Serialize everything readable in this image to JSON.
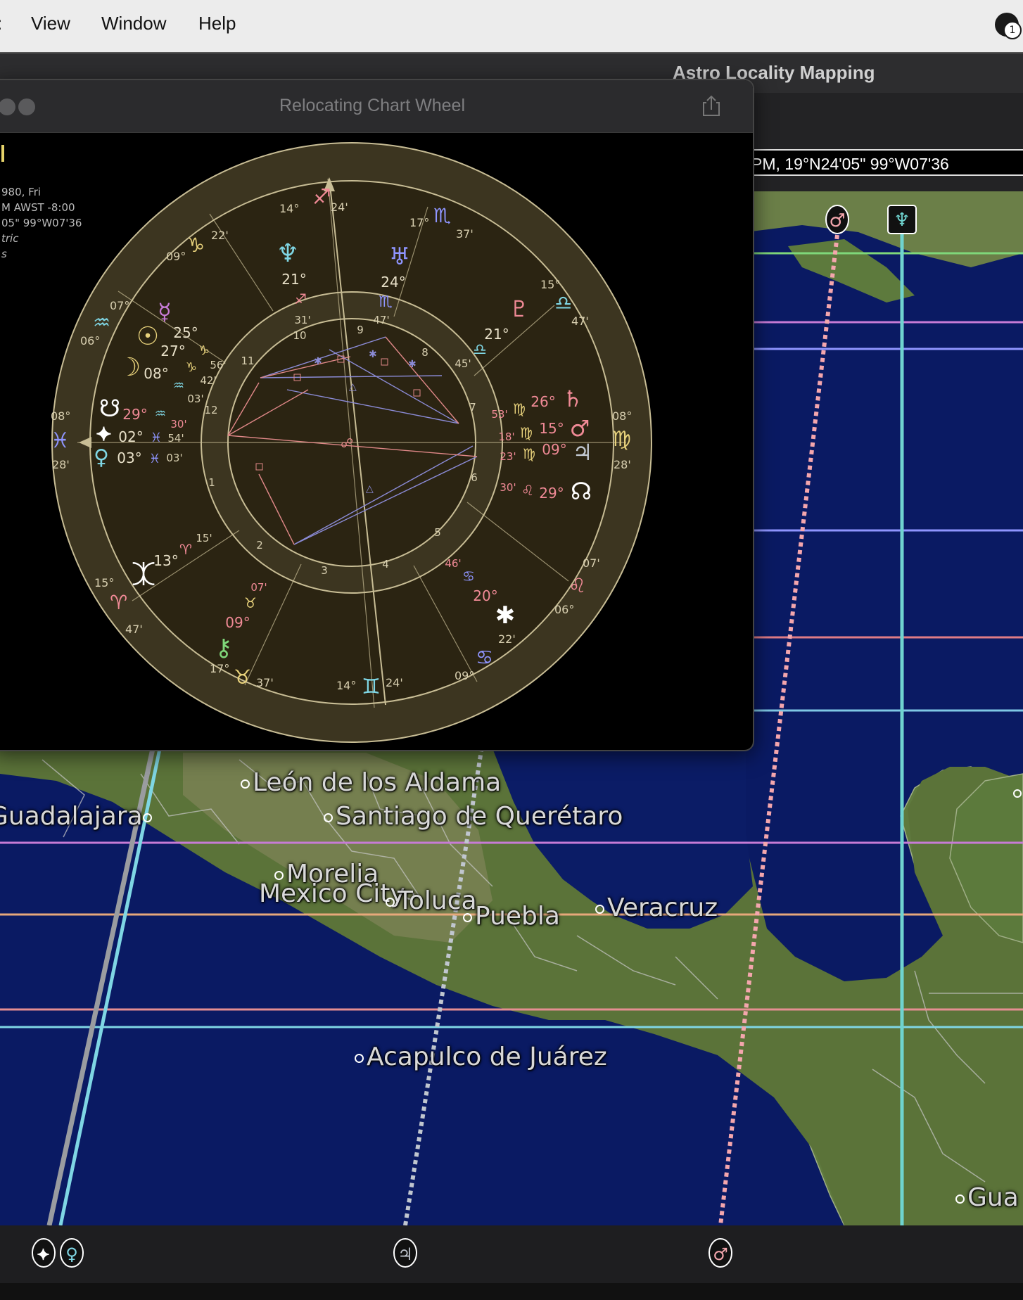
{
  "menu": {
    "items": [
      "View",
      "Window",
      "Help"
    ],
    "notification_count": "1"
  },
  "main_window": {
    "title": "Astro Locality Mapping",
    "location_field": "PM, 19°N24'05\" 99°W07'36"
  },
  "chart_window": {
    "title": "Relocating Chart Wheel",
    "side_info": [
      "980, Fri",
      "M AWST -8:00",
      "05\" 99°W07'36",
      "tric",
      "s"
    ]
  },
  "map": {
    "cities": [
      {
        "name": "León de los Aldama"
      },
      {
        "name": "Guadalajara"
      },
      {
        "name": "Santiago de Querétaro"
      },
      {
        "name": "Morelia"
      },
      {
        "name": "Mexico City"
      },
      {
        "name": "Toluca"
      },
      {
        "name": "Puebla"
      },
      {
        "name": "Veracruz"
      },
      {
        "name": "Acapulco de Juárez"
      },
      {
        "name": "Gua"
      }
    ],
    "top_line_markers": [
      "mars-glyph",
      "neptune-glyph"
    ],
    "bottom_line_markers": [
      "chiron-glyph",
      "venus-glyph",
      "jupiter-glyph",
      "mars-glyph"
    ],
    "line_colors": {
      "mars": "#f4a6ad",
      "neptune": "#6fd3cf",
      "venus": "#7fd6e4",
      "jupiter": "#c0c6cf",
      "mercury_h": "#c77bd6",
      "moon_h": "#8f95ff",
      "sun_h": "#e7a87b",
      "green_h": "#7fd77a"
    }
  },
  "wheel": {
    "cusps": {
      "asc": {
        "deg": "08°",
        "min": "28'",
        "sign": "♓"
      },
      "dsc": {
        "deg": "08°",
        "min": "28'",
        "sign": "♍"
      },
      "mc": {
        "deg": "14°",
        "min": "24'",
        "sign": "♐"
      },
      "ic": {
        "deg": "14°",
        "min": "24'",
        "sign": "♊"
      },
      "c11": {
        "deg": "17°",
        "min": "37'",
        "sign": "♏"
      },
      "c12": {
        "deg": "15°",
        "min": "47'",
        "sign": "♎"
      },
      "c5": {
        "deg": "17°",
        "min": "37'",
        "sign": "♉"
      },
      "c6": {
        "deg": "15°",
        "min": "47'",
        "sign": "♈"
      },
      "c10": {
        "deg": "09°",
        "min": "22'",
        "sign": "♑"
      },
      "c8": {
        "deg": "07°",
        "min": "06°",
        "sign": "♒"
      },
      "c2": {
        "deg": "07'",
        "min": "06°",
        "sign": "♌"
      },
      "c4": {
        "deg": "09°",
        "min": "22'",
        "sign": "♋"
      }
    },
    "houses": [
      "1",
      "2",
      "3",
      "4",
      "5",
      "6",
      "7",
      "8",
      "9",
      "10",
      "11",
      "12"
    ],
    "planets": {
      "neptune": {
        "glyph": "♆",
        "deg": "21°",
        "sign": "♐",
        "min": "31'"
      },
      "uranus": {
        "glyph": "♅",
        "deg": "24°",
        "sign": "♏",
        "min": "47'"
      },
      "pluto": {
        "glyph": "♇",
        "deg": "21°",
        "sign": "♎",
        "min": "45'"
      },
      "mercury": {
        "glyph": "☿",
        "deg": "25°",
        "sign": "♑",
        "min": "56'"
      },
      "sun": {
        "glyph": "☉",
        "deg": "27°",
        "sign": "♑",
        "min": "42'"
      },
      "moon": {
        "glyph": "☽",
        "deg": "08°",
        "sign": "♒",
        "min": "03'"
      },
      "saturn": {
        "glyph": "♄",
        "deg": "26°",
        "sign": "♍",
        "min": "53'"
      },
      "mars": {
        "glyph": "♂",
        "deg": "15°",
        "sign": "♍",
        "min": "18'"
      },
      "jupiter": {
        "glyph": "♃",
        "deg": "09°",
        "sign": "♍",
        "min": "23'"
      },
      "north_node": {
        "glyph": "☊",
        "deg": "29°",
        "sign": "♌",
        "min": "30'"
      },
      "south_node": {
        "glyph": "☋",
        "deg": "29°",
        "sign": "♒",
        "min": "30'"
      },
      "chiron": {
        "glyph": "⚷",
        "deg": "09°",
        "sign": "♉",
        "min": "07'"
      },
      "venus": {
        "glyph": "♀",
        "deg": "03°",
        "sign": "♓",
        "min": "03'"
      },
      "vesta": {
        "glyph": "⯌",
        "deg": "02°",
        "sign": "♓",
        "min": "54'"
      },
      "eris": {
        "glyph": "⯰",
        "deg": "13°",
        "sign": "♈",
        "min": "15'"
      },
      "pallas": {
        "glyph": "✱",
        "deg": "20°",
        "sign": "♋",
        "min": "46'"
      }
    }
  }
}
